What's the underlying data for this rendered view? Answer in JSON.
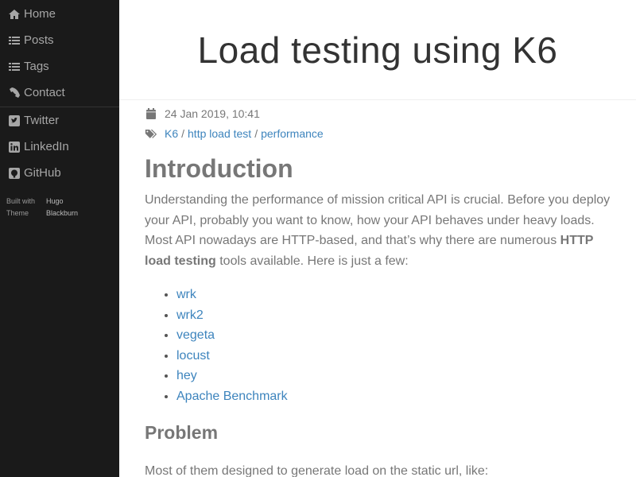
{
  "sidebar": {
    "nav": [
      {
        "label": "Home",
        "icon": "home-icon"
      },
      {
        "label": "Posts",
        "icon": "list-icon"
      },
      {
        "label": "Tags",
        "icon": "list-icon"
      },
      {
        "label": "Contact",
        "icon": "phone-icon"
      }
    ],
    "social": [
      {
        "label": "Twitter",
        "icon": "twitter-icon"
      },
      {
        "label": "LinkedIn",
        "icon": "linkedin-icon"
      },
      {
        "label": "GitHub",
        "icon": "github-icon"
      }
    ],
    "footer": {
      "built_with_label": "Built with",
      "built_with_value": "Hugo",
      "theme_label": "Theme",
      "theme_value": "Blackburn"
    }
  },
  "post": {
    "title": "Load testing using K6",
    "date": "24 Jan 2019, 10:41",
    "tags": [
      "K6",
      "http load test",
      "performance"
    ],
    "tag_separator": "/",
    "intro_heading": "Introduction",
    "intro_text_1": "Understanding the performance of mission critical API is crucial. Before you deploy your API, probably you want to know, how your API behaves under heavy loads. Most API nowadays are HTTP-based, and that’s why there are numerous ",
    "intro_text_bold": "HTTP load testing",
    "intro_text_2": " tools available. Here is just a few:",
    "tools": [
      "wrk",
      "wrk2",
      "vegeta",
      "locust",
      "hey",
      "Apache Benchmark"
    ],
    "problem_heading": "Problem",
    "problem_text": "Most of them designed to generate load on the static url, like:"
  },
  "colors": {
    "sidebar_bg": "#1a1a1a",
    "link": "#3d84bd",
    "text": "#777777"
  }
}
